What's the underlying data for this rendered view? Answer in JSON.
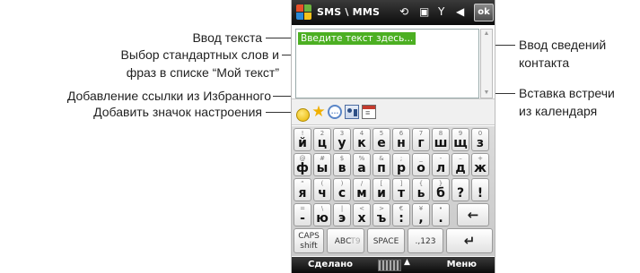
{
  "annotations": {
    "text_input": "Ввод текста",
    "standard_words_line1": "Выбор стандартных слов и",
    "standard_words_line2": "фраз в списке “Мой текст”",
    "favorites_link": "Добавление ссылки из Избранного",
    "mood_icon": "Добавить значок настроения",
    "contact_line1": "Ввод сведений",
    "contact_line2": "контакта",
    "calendar_line1": "Вставка встречи",
    "calendar_line2": "из календаря"
  },
  "phone": {
    "title": "SMS \\ MMS",
    "status_icons": {
      "phone": "⟲",
      "battery": "▣",
      "signal": "Y",
      "volume": "◀"
    },
    "ok_label": "ok",
    "input_placeholder": "Введите текст здесь...",
    "icons": [
      "smiley-icon",
      "star-icon",
      "text-bubble-icon",
      "contact-card-icon",
      "calendar-icon"
    ],
    "keyboard": {
      "row1": [
        {
          "sub": "!",
          "main": "й"
        },
        {
          "sub": "2",
          "main": "ц"
        },
        {
          "sub": "3",
          "main": "у"
        },
        {
          "sub": "4",
          "main": "к"
        },
        {
          "sub": "5",
          "main": "е"
        },
        {
          "sub": "6",
          "main": "н"
        },
        {
          "sub": "7",
          "main": "г"
        },
        {
          "sub": "8",
          "main": "ш"
        },
        {
          "sub": "9",
          "main": "щ"
        },
        {
          "sub": "0",
          "main": "з"
        }
      ],
      "row2": [
        {
          "sub": "@",
          "main": "ф"
        },
        {
          "sub": "#",
          "main": "ы"
        },
        {
          "sub": "$",
          "main": "в"
        },
        {
          "sub": "%",
          "main": "а"
        },
        {
          "sub": "&",
          "main": "п"
        },
        {
          "sub": ";",
          "main": "р"
        },
        {
          "sub": "_",
          "main": "о"
        },
        {
          "sub": "-",
          "main": "л"
        },
        {
          "sub": "–",
          "main": "д"
        },
        {
          "sub": "+",
          "main": "ж"
        }
      ],
      "row3": [
        {
          "sub": "“",
          "main": "я"
        },
        {
          "sub": "(",
          "main": "ч"
        },
        {
          "sub": ")",
          "main": "с"
        },
        {
          "sub": "/",
          "main": "м"
        },
        {
          "sub": "[",
          "main": "и"
        },
        {
          "sub": "]",
          "main": "т"
        },
        {
          "sub": "{",
          "main": "ь"
        },
        {
          "sub": "}",
          "main": "б"
        },
        {
          "sub": "",
          "main": "?"
        },
        {
          "sub": "",
          "main": "!"
        }
      ],
      "row4": [
        {
          "sub": "=",
          "main": "-"
        },
        {
          "sub": "\\",
          "main": "ю"
        },
        {
          "sub": "|",
          "main": "э"
        },
        {
          "sub": "<",
          "main": "х"
        },
        {
          "sub": ">",
          "main": "ъ"
        },
        {
          "sub": "€",
          "main": ":"
        },
        {
          "sub": "¥",
          "main": ","
        },
        {
          "sub": "•",
          "main": "."
        }
      ],
      "backspace": "←",
      "caps_label": "CAPS",
      "shift_label": "shift",
      "abc_label": "ABC",
      "t9_label": "T9",
      "space_label": "SPACE",
      "num_label": ".,123",
      "enter": "↵"
    },
    "softkeys": {
      "left": "Сделано",
      "right": "Меню",
      "arrow": "▲"
    }
  }
}
